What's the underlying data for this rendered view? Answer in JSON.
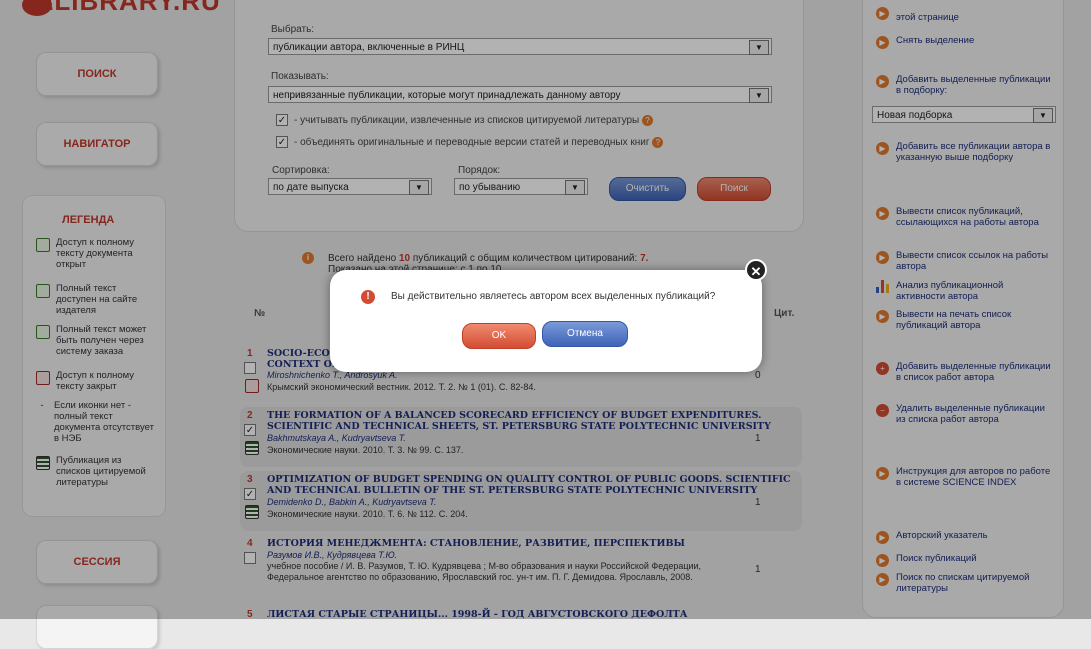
{
  "logo": {
    "text": "ELIBRARY.RU"
  },
  "nav": {
    "search": "ПОИСК",
    "navigator": "НАВИГАТОР",
    "session": "СЕССИЯ"
  },
  "legend": {
    "title": "ЛЕГЕНДА",
    "items": [
      "Доступ к полному тексту документа открыт",
      "Полный текст доступен на сайте издателя",
      "Полный текст может быть получен через систему заказа",
      "Доступ к полному тексту закрыт",
      "Если иконки нет - полный текст документа отсутствует в НЭБ",
      "Публикация из списков цитируемой литературы"
    ]
  },
  "form": {
    "select_label": "Выбрать:",
    "select_value": "публикации автора, включенные в РИНЦ",
    "show_label": "Показывать:",
    "show_value": "непривязанные публикации, которые могут принадлежать данному автору",
    "check1": "- учитывать публикации, извлеченные из списков цитируемой литературы",
    "check2": "- объединять оригинальные и переводные версии статей и переводных книг",
    "sort_label": "Сортировка:",
    "sort_value": "по дате выпуска",
    "order_label": "Порядок:",
    "order_value": "по убыванию",
    "clear_button": "Очистить",
    "search_button": "Поиск"
  },
  "results": {
    "found_prefix": "Всего найдено",
    "found_count": "10",
    "found_mid": "публикаций с общим количеством цитирований:",
    "citations": "7.",
    "shown_text": "Показано на этой странице: с 1 по 10",
    "col_num": "№",
    "col_cit": "Цит."
  },
  "rows": [
    {
      "num": "1",
      "title": "SOCIO-ECO",
      "title2": "CONTEXT OF",
      "authors": "Miroshnichenko T., Androsyuk A.",
      "source": "Крымский экономический вестник. 2012. Т. 2. № 1 (01). С. 82-84.",
      "cit": "0"
    },
    {
      "num": "2",
      "title": "THE FORMATION OF A BALANCED SCORECARD EFFICIENCY OF BUDGET EXPENDITURES.",
      "title2": "SCIENTIFIC AND TECHNICAL SHEETS, ST. PETERSBURG STATE POLYTECHNIC UNIVERSITY",
      "authors": "Bakhmutskaya A., Kudryavtseva T.",
      "source": "Экономические науки. 2010. Т. 3. № 99. С. 137.",
      "cit": "1"
    },
    {
      "num": "3",
      "title": "OPTIMIZATION OF BUDGET SPENDING ON QUALITY CONTROL OF PUBLIC GOODS. SCIENTIFIC",
      "title2": "AND TECHNICAL BULLETIN OF THE ST. PETERSBURG STATE POLYTECHNIC UNIVERSITY",
      "authors": "Demidenko D., Babkin A., Kudryavtseva T.",
      "source": "Экономические науки. 2010. Т. 6. № 112. С. 204.",
      "cit": "1"
    },
    {
      "num": "4",
      "title": "ИСТОРИЯ МЕНЕДЖМЕНТА: СТАНОВЛЕНИЕ, РАЗВИТИЕ, ПЕРСПЕКТИВЫ",
      "authors": "Разумов И.В., Кудрявцева Т.Ю.",
      "source": "учебное пособие / И. В. Разумов, Т. Ю. Кудрявцева ; М-во образования и науки Российской Федерации, Федеральное агентство по образованию, Ярославский гос. ун-т им. П. Г. Демидова. Ярославль, 2008.",
      "cit": "1"
    },
    {
      "num": "5",
      "title": "ЛИСТАЯ СТАРЫЕ СТРАНИЦЫ... 1998-Й - ГОД АВГУСТОВСКОГО ДЕФОЛТА"
    }
  ],
  "right": {
    "top_partial": "этой странице",
    "deselect": "Снять выделение",
    "add_to_collection": "Добавить выделенные публикации в подборку:",
    "collection_value": "Новая подборка",
    "add_all": "Добавить все публикации автора в указанную выше подборку",
    "list_citing": "Вывести список публикаций, ссылающихся на работы автора",
    "list_refs": "Вывести список ссылок на работы автора",
    "analysis": "Анализ публикационной активности автора",
    "print": "Вывести на печать список публикаций автора",
    "add_to_works": "Добавить выделенные публикации в список работ автора",
    "remove_from_works": "Удалить выделенные публикации из списка работ автора",
    "instructions": "Инструкция для авторов по работе в системе SCIENCE INDEX",
    "author_index": "Авторский указатель",
    "pub_search": "Поиск публикаций",
    "ref_search": "Поиск по спискам цитируемой литературы"
  },
  "dialog": {
    "message": "Вы действительно являетесь автором всех выделенных публикаций?",
    "ok": "OK",
    "cancel": "Отмена"
  }
}
